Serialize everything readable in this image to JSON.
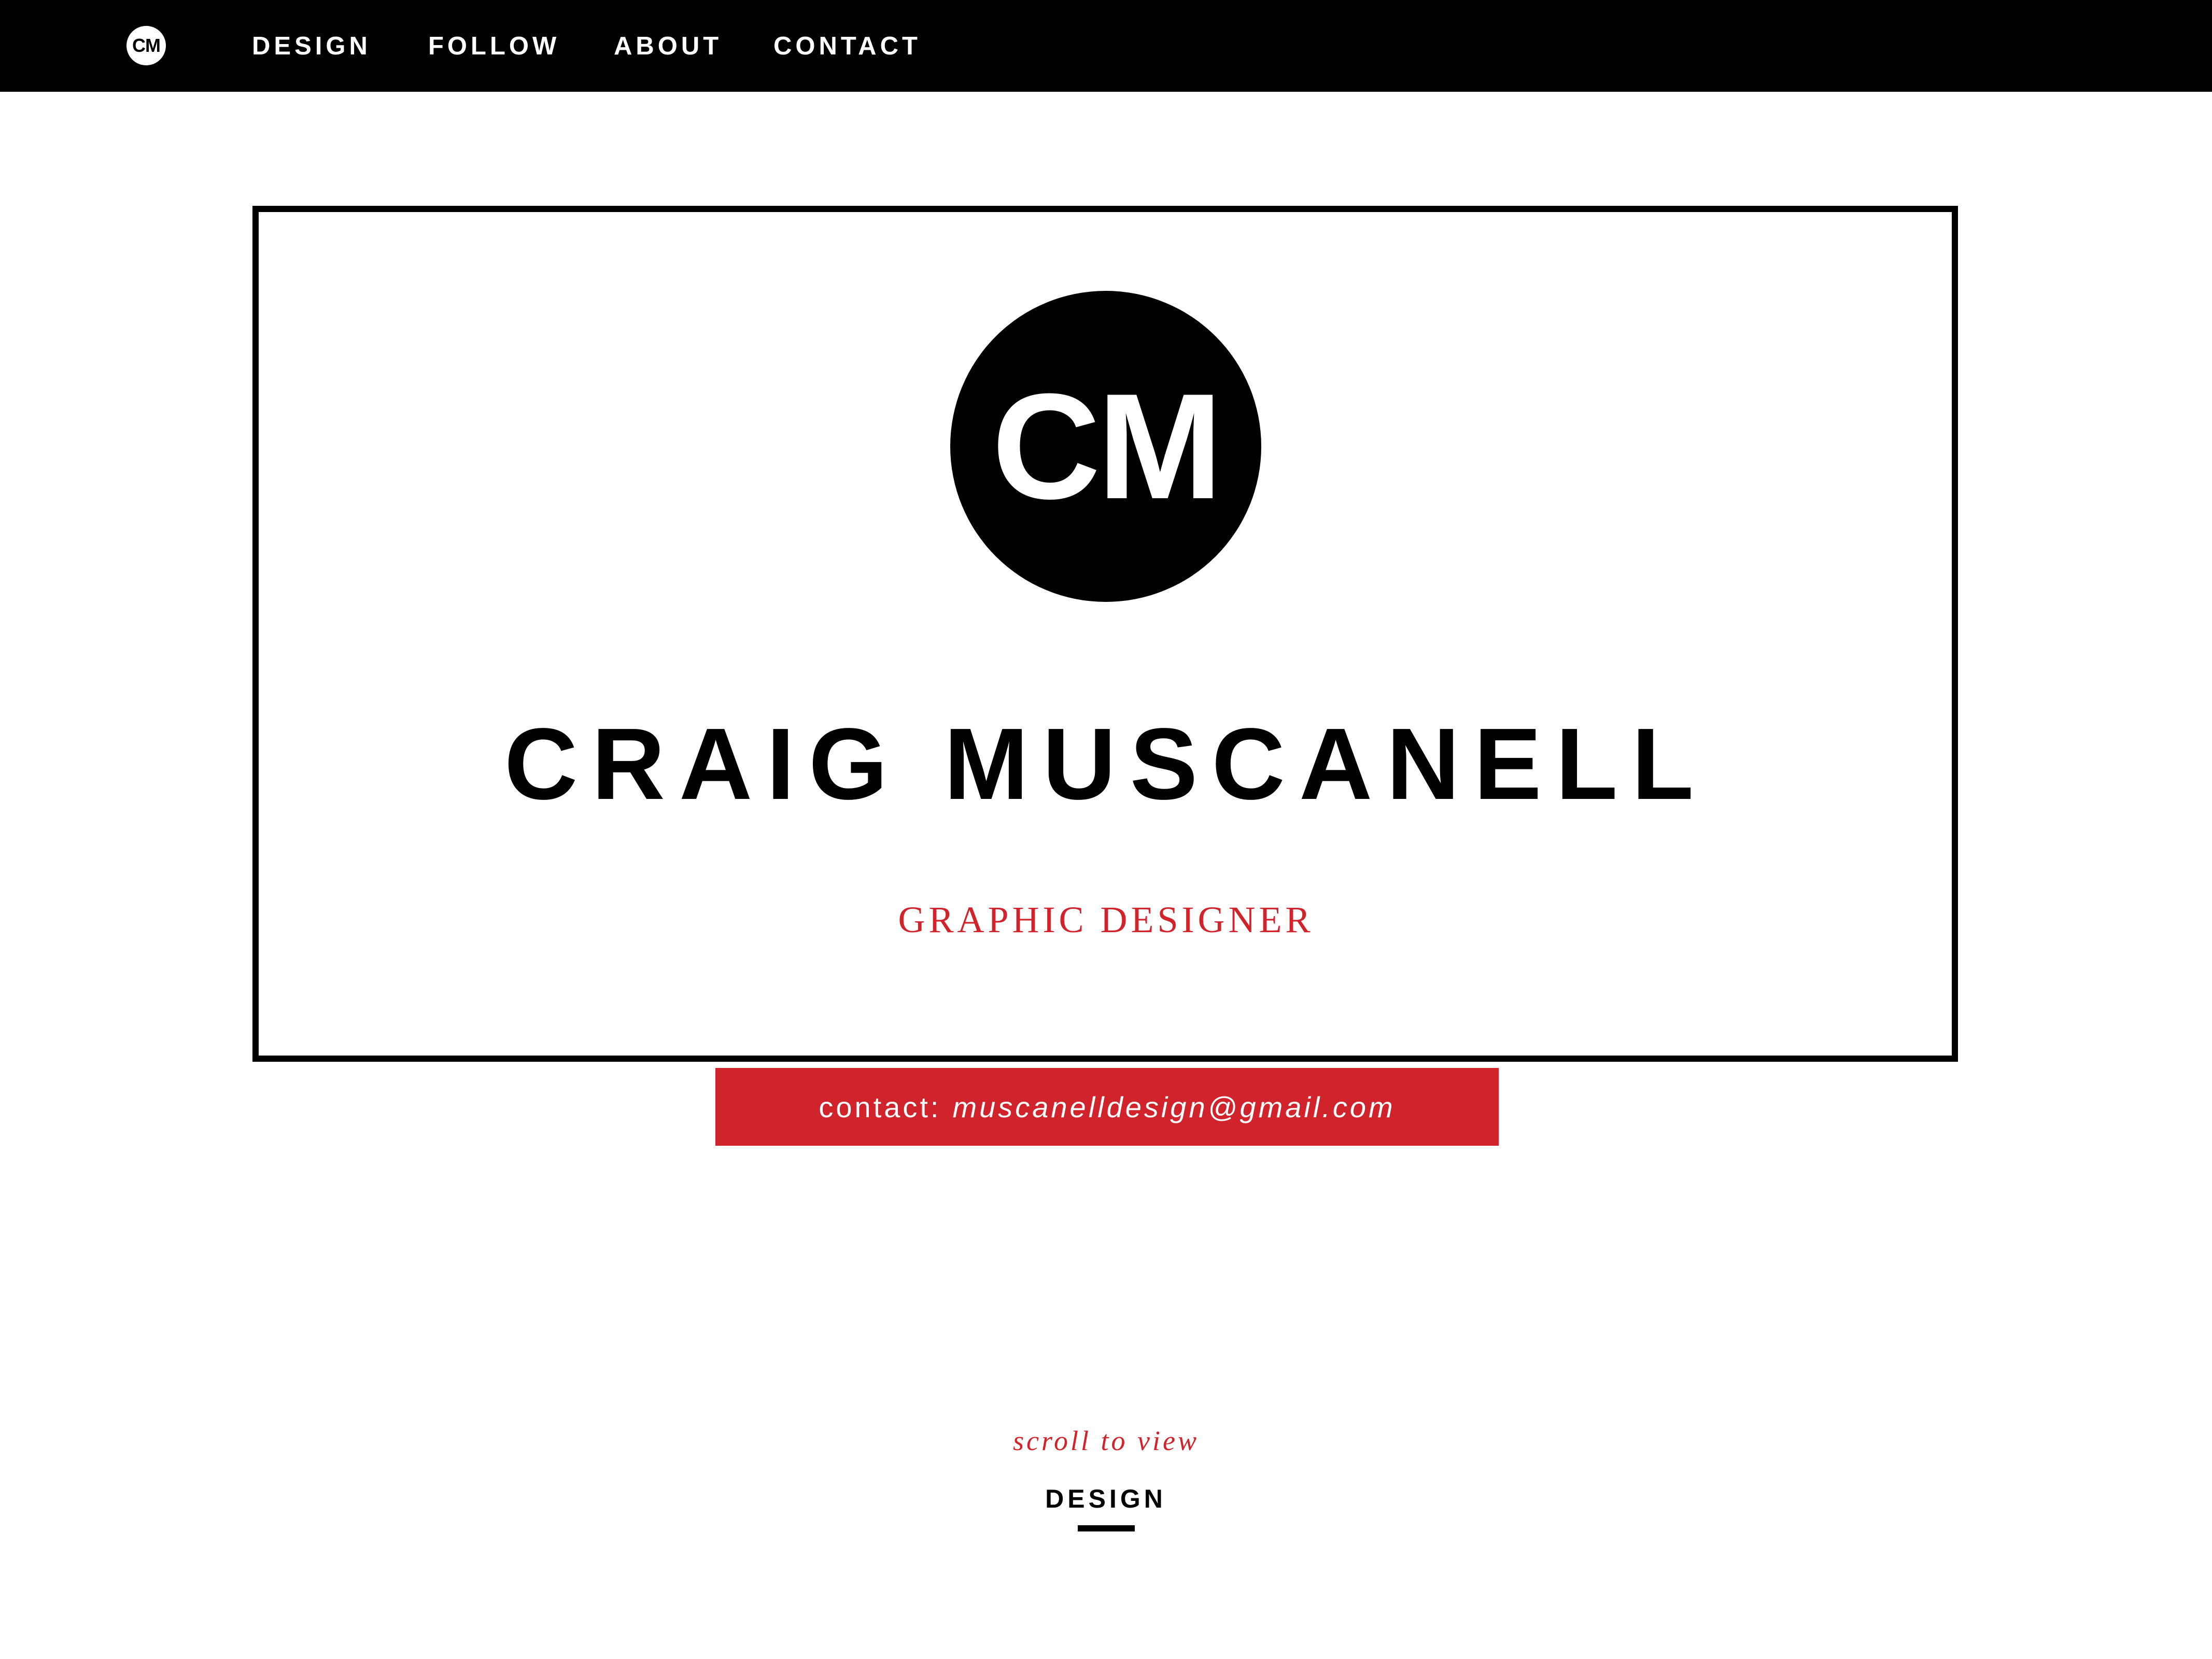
{
  "nav": {
    "logo_text": "CM",
    "items": [
      {
        "label": "DESIGN"
      },
      {
        "label": "FOLLOW"
      },
      {
        "label": "ABOUT"
      },
      {
        "label": "CONTACT"
      }
    ]
  },
  "hero": {
    "logo_text": "CM",
    "name": "CRAIG MUSCANELL",
    "role": "GRAPHIC DESIGNER"
  },
  "contact": {
    "prefix": "contact:",
    "email": "muscanelldesign@gmail.com"
  },
  "scroll": {
    "hint": "scroll to view",
    "target_label": "DESIGN"
  },
  "colors": {
    "nav_background": "#000000",
    "accent_red": "#d0232b",
    "page_background": "#ffffff"
  }
}
